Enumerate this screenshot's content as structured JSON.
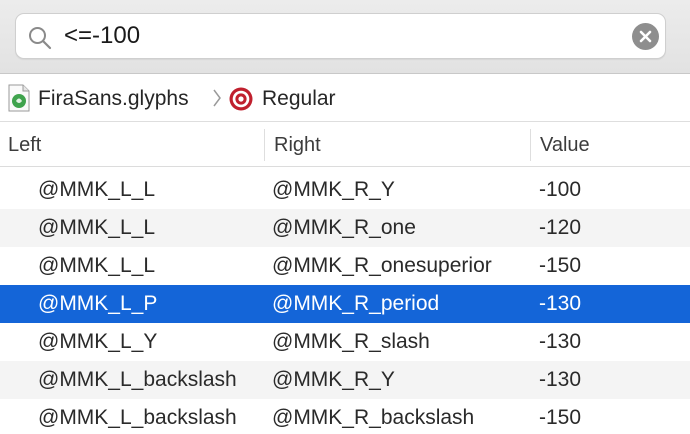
{
  "search": {
    "query": "<=-100"
  },
  "breadcrumb": {
    "file": "FiraSans.glyphs",
    "master": "Regular"
  },
  "table": {
    "columns": [
      "Left",
      "Right",
      "Value"
    ],
    "rows": [
      {
        "left": "@MMK_L_L",
        "right": "@MMK_R_Y",
        "value": "-100",
        "selected": false
      },
      {
        "left": "@MMK_L_L",
        "right": "@MMK_R_one",
        "value": "-120",
        "selected": false
      },
      {
        "left": "@MMK_L_L",
        "right": "@MMK_R_onesuperior",
        "value": "-150",
        "selected": false
      },
      {
        "left": "@MMK_L_P",
        "right": "@MMK_R_period",
        "value": "-130",
        "selected": true
      },
      {
        "left": "@MMK_L_Y",
        "right": "@MMK_R_slash",
        "value": "-130",
        "selected": false
      },
      {
        "left": "@MMK_L_backslash",
        "right": "@MMK_R_Y",
        "value": "-130",
        "selected": false
      },
      {
        "left": "@MMK_L_backslash",
        "right": "@MMK_R_backslash",
        "value": "-150",
        "selected": false
      }
    ]
  },
  "colors": {
    "selection": "#1465d8",
    "alt_row": "#f4f4f4",
    "master_icon": "#c0202e",
    "file_icon": "#3fa34d"
  },
  "icons": [
    "search-icon",
    "clear-icon",
    "glyphs-file-icon",
    "chevron-right-icon",
    "master-target-icon"
  ]
}
